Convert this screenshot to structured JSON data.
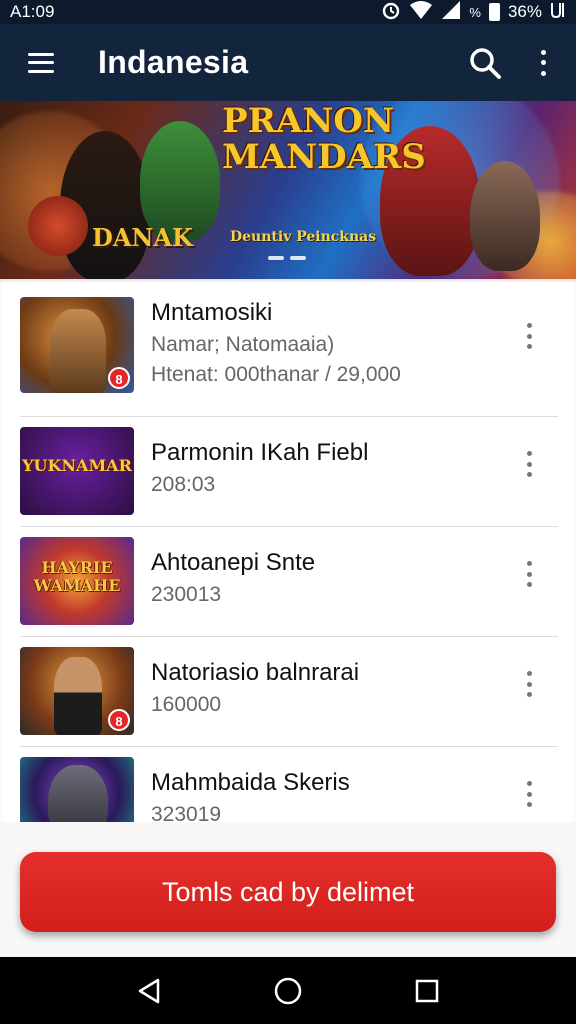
{
  "status_bar": {
    "time": "A1:09",
    "battery_text": "36%",
    "percent_symbol": "%",
    "icons": [
      "alarm-icon",
      "wifi-icon",
      "signal-icon",
      "battery-icon",
      "data-icon"
    ]
  },
  "app_bar": {
    "title": "Indanesia",
    "icons": [
      "menu-icon",
      "search-icon",
      "overflow-menu-icon"
    ]
  },
  "banner": {
    "title": "PRANON MANDARS",
    "left_text": "DANAK",
    "sub_text": "Deuntiv Peincknas"
  },
  "list": {
    "items": [
      {
        "title": "Mntamosiki",
        "line1": "Namar; Natomaaia)",
        "line2": "Htenat: 000thanar / 29,000",
        "thumb_badge": "8"
      },
      {
        "title": "Parmonin IKah Fiebl",
        "line1": "208:03",
        "thumb_text": "YUKNAMAR"
      },
      {
        "title": "Ahtoanepi Snte",
        "line1": "230013",
        "thumb_text": "HAYRIE WAMAHE"
      },
      {
        "title": "Natoriasio balnrarai",
        "line1": "160000",
        "thumb_badge": "8"
      },
      {
        "title": "Mahmbaida Skeris",
        "line1": "323019"
      }
    ]
  },
  "footer": {
    "button_label": "Tomls cad by delimet"
  },
  "colors": {
    "app_bar": "#13243d",
    "status_bar": "#0d1a2e",
    "accent_red": "#d9231f"
  }
}
